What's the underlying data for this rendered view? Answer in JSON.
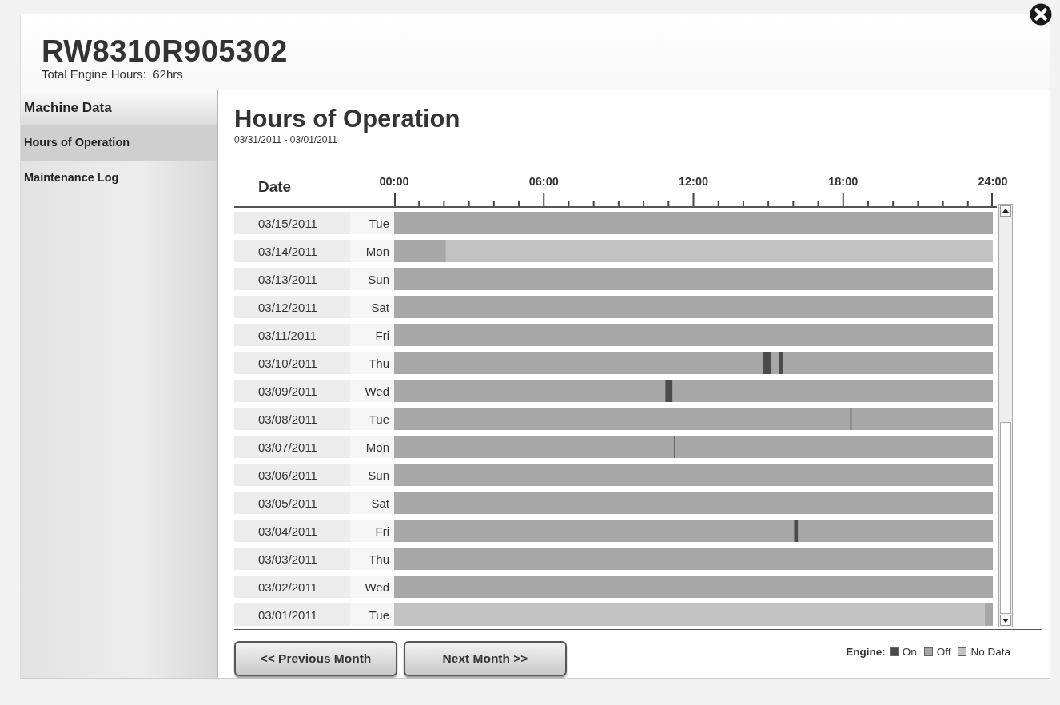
{
  "header": {
    "title": "RW8310R905302",
    "subtitle": "Total Engine Hours:  62hrs"
  },
  "sidebar": {
    "heading": "Machine Data",
    "items": [
      {
        "label": "Hours of Operation",
        "selected": true
      },
      {
        "label": "Maintenance Log",
        "selected": false
      }
    ]
  },
  "main": {
    "title": "Hours of Operation",
    "date_range": "03/31/2011 - 03/01/2011"
  },
  "timeline": {
    "date_heading": "Date",
    "weekdays": [
      "Tue",
      "Mon",
      "Sun",
      "Sat",
      "Fri",
      "Thu",
      "Wed",
      "Tue",
      "Mon",
      "Sun",
      "Sat",
      "Fri",
      "Thu",
      "Wed",
      "Tue"
    ],
    "chart_data": {
      "type": "bar",
      "orientation": "horizontal",
      "stacked": true,
      "categories": [
        "03/15/2011",
        "03/14/2011",
        "03/13/2011",
        "03/12/2011",
        "03/11/2011",
        "03/10/2011",
        "03/09/2011",
        "03/08/2011",
        "03/07/2011",
        "03/06/2011",
        "03/05/2011",
        "03/04/2011",
        "03/03/2011",
        "03/02/2011",
        "03/01/2011"
      ],
      "xlim": [
        0,
        24
      ],
      "xticks": [
        {
          "value": 0,
          "label": "00:00"
        },
        {
          "value": 6,
          "label": "06:00"
        },
        {
          "value": 12,
          "label": "12:00"
        },
        {
          "value": 18,
          "label": "18:00"
        },
        {
          "value": 24,
          "label": "24:00"
        }
      ],
      "series": [
        {
          "color": "#a7a7a7",
          "values": [
            24,
            2.08,
            24,
            24,
            24,
            14.8,
            10.87,
            18.28,
            11.22,
            24,
            24,
            16.03,
            24,
            24,
            null
          ]
        },
        {
          "color": "#4a4a4a",
          "values": [
            null,
            null,
            null,
            null,
            null,
            0.3,
            0.3,
            0.07,
            0.07,
            null,
            null,
            0.17,
            null,
            null,
            null
          ]
        },
        {
          "color": "#a7a7a7",
          "values": [
            null,
            null,
            null,
            null,
            null,
            0.32,
            12.83,
            5.65,
            12.71,
            null,
            null,
            7.8,
            null,
            null,
            null
          ]
        },
        {
          "color": "#4a4a4a",
          "values": [
            null,
            null,
            null,
            null,
            null,
            0.18,
            null,
            null,
            null,
            null,
            null,
            null,
            null,
            null,
            null
          ]
        },
        {
          "color": "#a7a7a7",
          "values": [
            null,
            null,
            null,
            null,
            null,
            8.4,
            null,
            null,
            null,
            null,
            null,
            null,
            null,
            null,
            null
          ]
        },
        {
          "color": "#c2c2c2",
          "values": [
            null,
            21.92,
            null,
            null,
            null,
            null,
            null,
            null,
            null,
            null,
            null,
            null,
            null,
            null,
            23.67
          ]
        },
        {
          "color": "#a7a7a7",
          "values": [
            null,
            null,
            null,
            null,
            null,
            null,
            null,
            null,
            null,
            null,
            null,
            null,
            null,
            null,
            0.33
          ]
        }
      ]
    }
  },
  "buttons": [
    {
      "label": "<< Previous Month"
    },
    {
      "label": "Next Month >>"
    }
  ],
  "legend": {
    "title": "Engine:",
    "items": [
      {
        "label": "On",
        "color": "#4a4a4a"
      },
      {
        "label": "Off",
        "color": "#a7a7a7"
      },
      {
        "label": "No Data",
        "color": "#c2c2c2"
      }
    ]
  }
}
